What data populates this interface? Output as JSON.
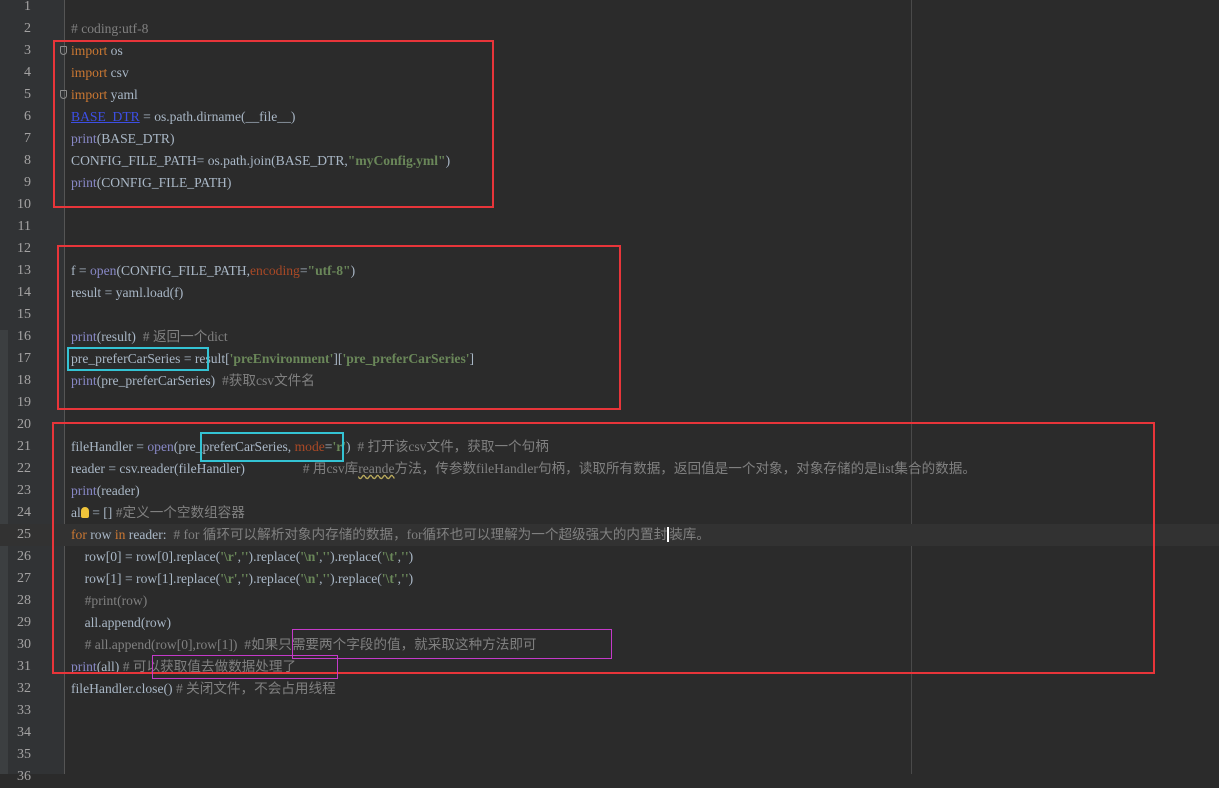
{
  "editor": {
    "current_line": "25",
    "lines": [
      {
        "n": "1",
        "tokens": []
      },
      {
        "n": "2",
        "tokens": [
          {
            "t": "# coding:utf-8",
            "c": "c"
          }
        ]
      },
      {
        "n": "3",
        "fold": true,
        "tokens": [
          {
            "t": "import",
            "c": "kw"
          },
          {
            "t": " os"
          }
        ]
      },
      {
        "n": "4",
        "tokens": [
          {
            "t": "import",
            "c": "kw"
          },
          {
            "t": " csv"
          }
        ]
      },
      {
        "n": "5",
        "fold": true,
        "tokens": [
          {
            "t": "import",
            "c": "kw"
          },
          {
            "t": " yaml"
          }
        ]
      },
      {
        "n": "6",
        "tokens": [
          {
            "t": "BASE_DTR",
            "c": "u"
          },
          {
            "t": " = os.path.dirname(__file__)"
          }
        ]
      },
      {
        "n": "7",
        "tokens": [
          {
            "t": "print",
            "c": "b"
          },
          {
            "t": "(BASE_DTR)"
          }
        ]
      },
      {
        "n": "8",
        "tokens": [
          {
            "t": "CONFIG_FILE_PATH= os.path.join(BASE_DTR,"
          },
          {
            "t": "\"myConfig.yml\"",
            "c": "s"
          },
          {
            "t": ")"
          }
        ]
      },
      {
        "n": "9",
        "tokens": [
          {
            "t": "print",
            "c": "b"
          },
          {
            "t": "(CONFIG_FILE_PATH)"
          }
        ]
      },
      {
        "n": "10",
        "tokens": []
      },
      {
        "n": "11",
        "tokens": []
      },
      {
        "n": "12",
        "tokens": []
      },
      {
        "n": "13",
        "tokens": [
          {
            "t": "f = "
          },
          {
            "t": "open",
            "c": "b"
          },
          {
            "t": "(CONFIG_FILE_PATH,"
          },
          {
            "t": "encoding",
            "c": "m"
          },
          {
            "t": "="
          },
          {
            "t": "\"utf-8\"",
            "c": "s"
          },
          {
            "t": ")"
          }
        ]
      },
      {
        "n": "14",
        "tokens": [
          {
            "t": "result = yaml.load(f)"
          }
        ]
      },
      {
        "n": "15",
        "tokens": []
      },
      {
        "n": "16",
        "tokens": [
          {
            "t": "print",
            "c": "b"
          },
          {
            "t": "(result)  "
          },
          {
            "t": "# 返回一个dict",
            "c": "c"
          }
        ]
      },
      {
        "n": "17",
        "tokens": [
          {
            "t": "pre_preferCarSeries = result["
          },
          {
            "t": "'preEnvironment'",
            "c": "s"
          },
          {
            "t": "]["
          },
          {
            "t": "'pre_preferCarSeries'",
            "c": "s"
          },
          {
            "t": "]"
          }
        ]
      },
      {
        "n": "18",
        "tokens": [
          {
            "t": "print",
            "c": "b"
          },
          {
            "t": "(pre_preferCarSeries)  "
          },
          {
            "t": "#获取csv文件名",
            "c": "c"
          }
        ]
      },
      {
        "n": "19",
        "tokens": []
      },
      {
        "n": "20",
        "tokens": []
      },
      {
        "n": "21",
        "tokens": [
          {
            "t": "fileHandler = "
          },
          {
            "t": "open",
            "c": "b"
          },
          {
            "t": "(pre_preferCarSeries, "
          },
          {
            "t": "mode",
            "c": "m"
          },
          {
            "t": "="
          },
          {
            "t": "'r'",
            "c": "s"
          },
          {
            "t": ")  "
          },
          {
            "t": "# 打开该csv文件，获取一个句柄",
            "c": "c"
          }
        ]
      },
      {
        "n": "22",
        "tokens": [
          {
            "t": "reader = csv.reader(fileHandler)                 "
          },
          {
            "t": "# 用csv库",
            "c": "c"
          },
          {
            "t": "reande",
            "c": "csq"
          },
          {
            "t": "方法，传参数fileHandler句柄，读取所有数据，返回值是一个对象，对象存储的是list集合的数据。",
            "c": "c"
          }
        ]
      },
      {
        "n": "23",
        "tokens": [
          {
            "t": "print",
            "c": "b"
          },
          {
            "t": "(reader)"
          }
        ]
      },
      {
        "n": "24",
        "tokens": [
          {
            "t": "al"
          },
          {
            "t": "",
            "c": "bulb"
          },
          {
            "t": " = [] "
          },
          {
            "t": "#定义一个空数组容器",
            "c": "c"
          }
        ]
      },
      {
        "n": "25",
        "tokens": [
          {
            "t": "for",
            "c": "kw"
          },
          {
            "t": " row "
          },
          {
            "t": "in",
            "c": "kw"
          },
          {
            "t": " reader:  "
          },
          {
            "t": "# for 循环可以解析对象内存储的数据，for循环也可以理解为一个超级强大的内置封",
            "c": "c"
          },
          {
            "t": "装库。",
            "c": "ccur"
          }
        ]
      },
      {
        "n": "26",
        "tokens": [
          {
            "t": "    row[0] = row[0].replace("
          },
          {
            "t": "'\\r'",
            "c": "s"
          },
          {
            "t": ","
          },
          {
            "t": "''",
            "c": "s"
          },
          {
            "t": ").replace("
          },
          {
            "t": "'\\n'",
            "c": "s"
          },
          {
            "t": ","
          },
          {
            "t": "''",
            "c": "s"
          },
          {
            "t": ").replace("
          },
          {
            "t": "'\\t'",
            "c": "s"
          },
          {
            "t": ","
          },
          {
            "t": "''",
            "c": "s"
          },
          {
            "t": ")"
          }
        ]
      },
      {
        "n": "27",
        "tokens": [
          {
            "t": "    row[1] = row[1].replace("
          },
          {
            "t": "'\\r'",
            "c": "s"
          },
          {
            "t": ","
          },
          {
            "t": "''",
            "c": "s"
          },
          {
            "t": ").replace("
          },
          {
            "t": "'\\n'",
            "c": "s"
          },
          {
            "t": ","
          },
          {
            "t": "''",
            "c": "s"
          },
          {
            "t": ").replace("
          },
          {
            "t": "'\\t'",
            "c": "s"
          },
          {
            "t": ","
          },
          {
            "t": "''",
            "c": "s"
          },
          {
            "t": ")"
          }
        ]
      },
      {
        "n": "28",
        "tokens": [
          {
            "t": "    "
          },
          {
            "t": "#print(row)",
            "c": "c"
          }
        ]
      },
      {
        "n": "29",
        "tokens": [
          {
            "t": "    all.append(row)"
          }
        ]
      },
      {
        "n": "30",
        "tokens": [
          {
            "t": "    "
          },
          {
            "t": "# all.append(row[0],row[1])  #如果只需要两个字段的值，就采取这种方法即可",
            "c": "c"
          }
        ]
      },
      {
        "n": "31",
        "tokens": [
          {
            "t": "print",
            "c": "b"
          },
          {
            "t": "(all) "
          },
          {
            "t": "# 可以获取值去做数据处理了",
            "c": "c"
          }
        ]
      },
      {
        "n": "32",
        "tokens": [
          {
            "t": "fileHandler.close() "
          },
          {
            "t": "# 关闭文件，不会占用线程",
            "c": "c"
          }
        ]
      },
      {
        "n": "33",
        "tokens": []
      },
      {
        "n": "34",
        "tokens": []
      },
      {
        "n": "35",
        "tokens": []
      },
      {
        "n": "36",
        "tokens": []
      }
    ]
  },
  "colors": {
    "background": "#2b2b2b",
    "gutter": "#313335",
    "text": "#a9b7c6",
    "keyword": "#cc7832",
    "builtin": "#8888c6",
    "string": "#6a8759",
    "comment": "#808080",
    "kwarg": "#aa4926",
    "annotation_red": "#e8353a",
    "annotation_cyan": "#34c3d4",
    "annotation_magenta": "#c43ac9"
  }
}
